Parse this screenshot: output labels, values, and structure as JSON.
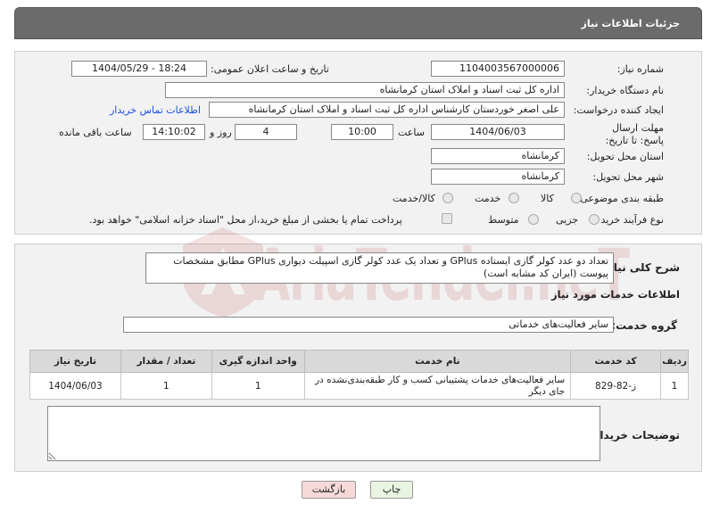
{
  "header": {
    "title": "جزئیات اطلاعات نیاز"
  },
  "form": {
    "need_number_label": "شماره نیاز:",
    "need_number": "1104003567000006",
    "announce_label": "تاریخ و ساعت اعلان عمومی:",
    "announce_value": "1404/05/29 - 18:24",
    "buyer_org_label": "نام دستگاه خریدار:",
    "buyer_org": "اداره کل ثبت اسناد و املاک استان کرمانشاه",
    "creator_label": "ایجاد کننده درخواست:",
    "creator": "علی اصغر خوردستان کارشناس اداره کل ثبت اسناد و املاک استان کرمانشاه",
    "contact_link": "اطلاعات تماس خریدار",
    "deadline_label": "مهلت ارسال پاسخ: تا تاریخ:",
    "deadline_date": "1404/06/03",
    "time_label": "ساعت",
    "deadline_time": "10:00",
    "days_value": "4",
    "days_label": "روز و",
    "remaining_time": "14:10:02",
    "remaining_label": "ساعت باقی مانده",
    "province_label": "استان محل تحویل:",
    "province": "کرمانشاه",
    "city_label": "شهر محل تحویل:",
    "city": "کرمانشاه",
    "category_label": "طبقه بندی موضوعی:",
    "category_options": [
      "کالا",
      "خدمت",
      "کالا/خدمت"
    ],
    "process_label": "نوع فرآیند خرید :",
    "process_options": [
      "جزیی",
      "متوسط"
    ],
    "payment_note": "پرداخت تمام یا بخشی از مبلغ خرید،از محل \"اسناد خزانه اسلامی\" خواهد بود."
  },
  "summary": {
    "label": "شرح کلی نیاز:",
    "text": "تعداد دو عدد کولر گازی ایستاده GPlus و تعداد یک عدد کولر گازی اسپیلت دیواری GPlus مطابق مشخصات پیوست (ایران کد مشابه است)"
  },
  "services": {
    "section_title": "اطلاعات خدمات مورد نیاز",
    "group_label": "گروه خدمت:",
    "group_value": "سایر فعالیت‌های خدماتی",
    "columns": [
      "ردیف",
      "کد خدمت",
      "نام خدمت",
      "واحد اندازه گیری",
      "تعداد / مقدار",
      "تاریخ نیاز"
    ],
    "rows": [
      {
        "index": "1",
        "code": "ز-82-829",
        "name": "سایر فعالیت‌های خدمات پشتیبانی کسب و کار طبقه‌بندی‌نشده در جای دیگر",
        "unit": "1",
        "qty": "1",
        "date": "1404/06/03"
      }
    ]
  },
  "buyer_notes_label": "توضیحات خریدار:",
  "buttons": {
    "print": "چاپ",
    "back": "بازگشت"
  },
  "watermark": {
    "text": "AriaTender.neT"
  },
  "colors": {
    "header_bg": "#6b6b6b",
    "link": "#1a4fd8",
    "back_button": "#f7d9d9",
    "print_button": "#e9f5e1"
  }
}
